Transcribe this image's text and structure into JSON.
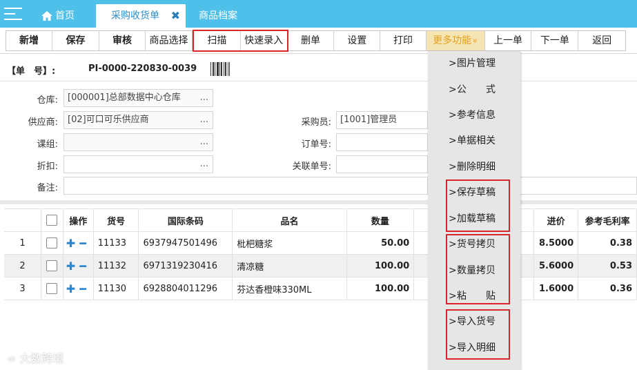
{
  "tabs": {
    "home": "首页",
    "active": "采购收货单",
    "goods": "商品档案"
  },
  "toolbar": {
    "add": "新增",
    "save": "保存",
    "audit": "审核",
    "select_goods": "商品选择",
    "scan": "扫描",
    "quick_entry": "快速录入",
    "delete_doc": "删单",
    "settings": "设置",
    "print": "打印",
    "more": "更多功能",
    "more_arrow": "»",
    "prev": "上一单",
    "next": "下一单",
    "back": "返回"
  },
  "doc": {
    "label": "【单　号】:",
    "number": "PI-0000-220830-0039"
  },
  "form": {
    "warehouse_label": "仓库:",
    "warehouse_value": "[000001]总部数据中心仓库",
    "supplier_label": "供应商:",
    "supplier_value": "[02]可口可乐供应商",
    "group_label": "课组:",
    "group_value": "",
    "discount_label": "折扣:",
    "discount_value": "",
    "remark_label": "备注:",
    "remark_value": "",
    "buyer_label": "采购员:",
    "buyer_value": "[1001]管理员",
    "order_label": "订单号:",
    "order_value": "",
    "related_label": "关联单号:",
    "related_value": "",
    "dots": "..."
  },
  "table": {
    "headers": {
      "op": "操作",
      "code": "货号",
      "barcode": "国际条码",
      "name": "品名",
      "qty": "数量",
      "price": "进价",
      "margin": "参考毛利率"
    },
    "rows": [
      {
        "idx": "1",
        "code": "11133",
        "barcode": "6937947501496",
        "name": "枇杷糖浆",
        "qty": "50.00",
        "price": "8.5000",
        "margin": "0.38"
      },
      {
        "idx": "2",
        "code": "11132",
        "barcode": "6971319230416",
        "name": "清凉糖",
        "qty": "100.00",
        "price": "5.6000",
        "margin": "0.53"
      },
      {
        "idx": "3",
        "code": "11130",
        "barcode": "6928804011296",
        "name": "芬达香橙味330ML",
        "qty": "100.00",
        "price": "1.6000",
        "margin": "0.36"
      }
    ]
  },
  "more_menu": {
    "arrow": ">",
    "items": [
      "图片管理",
      "公　　式",
      "参考信息",
      "单据相关",
      "删除明细",
      "保存草稿",
      "加载草稿",
      "货号拷贝",
      "数量拷贝",
      "粘　　贴",
      "导入货号",
      "导入明细"
    ]
  },
  "watermark": "大数跨境",
  "colors": {
    "tabbar": "#4fc0ea",
    "highlight_red": "#d9232b",
    "more_bg": "#f6e5b4",
    "more_text": "#e6a01c",
    "op_blue": "#2d86d0"
  }
}
